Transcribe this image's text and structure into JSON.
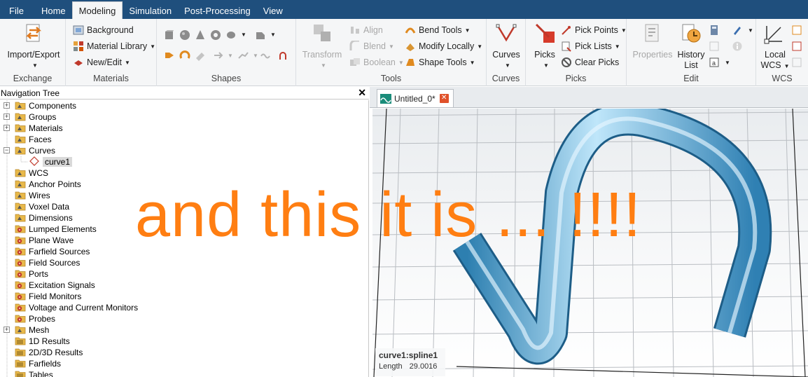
{
  "menu": {
    "items": [
      "File",
      "Home",
      "Modeling",
      "Simulation",
      "Post-Processing",
      "View"
    ],
    "active": "Modeling"
  },
  "ribbon": {
    "exchange": {
      "label": "Exchange",
      "import_export": "Import/Export"
    },
    "materials": {
      "label": "Materials",
      "background": "Background",
      "material_library": "Material Library",
      "new_edit": "New/Edit"
    },
    "shapes": {
      "label": "Shapes"
    },
    "tools": {
      "label": "Tools",
      "transform": "Transform",
      "align": "Align",
      "blend": "Blend",
      "boolean": "Boolean",
      "bend_tools": "Bend Tools",
      "modify_locally": "Modify Locally",
      "shape_tools": "Shape Tools"
    },
    "curves": {
      "label": "Curves",
      "curves": "Curves"
    },
    "picks": {
      "label": "Picks",
      "picks": "Picks",
      "pick_points": "Pick Points",
      "pick_lists": "Pick Lists",
      "clear_picks": "Clear Picks"
    },
    "edit": {
      "label": "Edit",
      "properties": "Properties",
      "history_list_1": "History",
      "history_list_2": "List"
    },
    "wcs": {
      "label": "WCS",
      "local_1": "Local",
      "local_2": "WCS"
    }
  },
  "nav": {
    "title": "Navigation Tree",
    "close": "✕",
    "items": [
      {
        "label": "Components",
        "expandable": true,
        "icon": "folder-icon"
      },
      {
        "label": "Groups",
        "expandable": true,
        "icon": "folder-icon"
      },
      {
        "label": "Materials",
        "expandable": true,
        "icon": "folder-icon"
      },
      {
        "label": "Faces",
        "expandable": false,
        "icon": "folder-icon"
      },
      {
        "label": "Curves",
        "expandable": true,
        "expanded": true,
        "icon": "folder-icon"
      },
      {
        "label": "curve1",
        "child": true,
        "selected": true,
        "icon": "curve-icon"
      },
      {
        "label": "WCS",
        "expandable": false,
        "icon": "folder-icon"
      },
      {
        "label": "Anchor Points",
        "expandable": false,
        "icon": "folder-icon"
      },
      {
        "label": "Wires",
        "expandable": false,
        "icon": "folder-icon"
      },
      {
        "label": "Voxel Data",
        "expandable": false,
        "icon": "folder-icon"
      },
      {
        "label": "Dimensions",
        "expandable": false,
        "icon": "folder-icon"
      },
      {
        "label": "Lumped Elements",
        "expandable": false,
        "icon": "source-folder-icon"
      },
      {
        "label": "Plane Wave",
        "expandable": false,
        "icon": "source-folder-icon"
      },
      {
        "label": "Farfield Sources",
        "expandable": false,
        "icon": "source-folder-icon"
      },
      {
        "label": "Field Sources",
        "expandable": false,
        "icon": "source-folder-icon"
      },
      {
        "label": "Ports",
        "expandable": false,
        "icon": "source-folder-icon"
      },
      {
        "label": "Excitation Signals",
        "expandable": false,
        "icon": "source-folder-icon"
      },
      {
        "label": "Field Monitors",
        "expandable": false,
        "icon": "source-folder-icon"
      },
      {
        "label": "Voltage and Current Monitors",
        "expandable": false,
        "icon": "source-folder-icon"
      },
      {
        "label": "Probes",
        "expandable": false,
        "icon": "source-folder-icon"
      },
      {
        "label": "Mesh",
        "expandable": true,
        "icon": "folder-icon"
      },
      {
        "label": "1D Results",
        "expandable": false,
        "icon": "results-folder-icon"
      },
      {
        "label": "2D/3D Results",
        "expandable": false,
        "icon": "results-folder-icon"
      },
      {
        "label": "Farfields",
        "expandable": false,
        "icon": "results-folder-icon"
      },
      {
        "label": "Tables",
        "expandable": false,
        "icon": "results-folder-icon"
      }
    ]
  },
  "viewport": {
    "tab_label": "Untitled_0*",
    "info_title": "curve1:spline1",
    "info_length_label": "Length",
    "info_length_value": "29.0016"
  },
  "overlay_text": "and this it is ... !!!!",
  "colors": {
    "menubar": "#1f4f7d",
    "overlay": "#ff7e12",
    "tube": "#5fb6e3"
  }
}
